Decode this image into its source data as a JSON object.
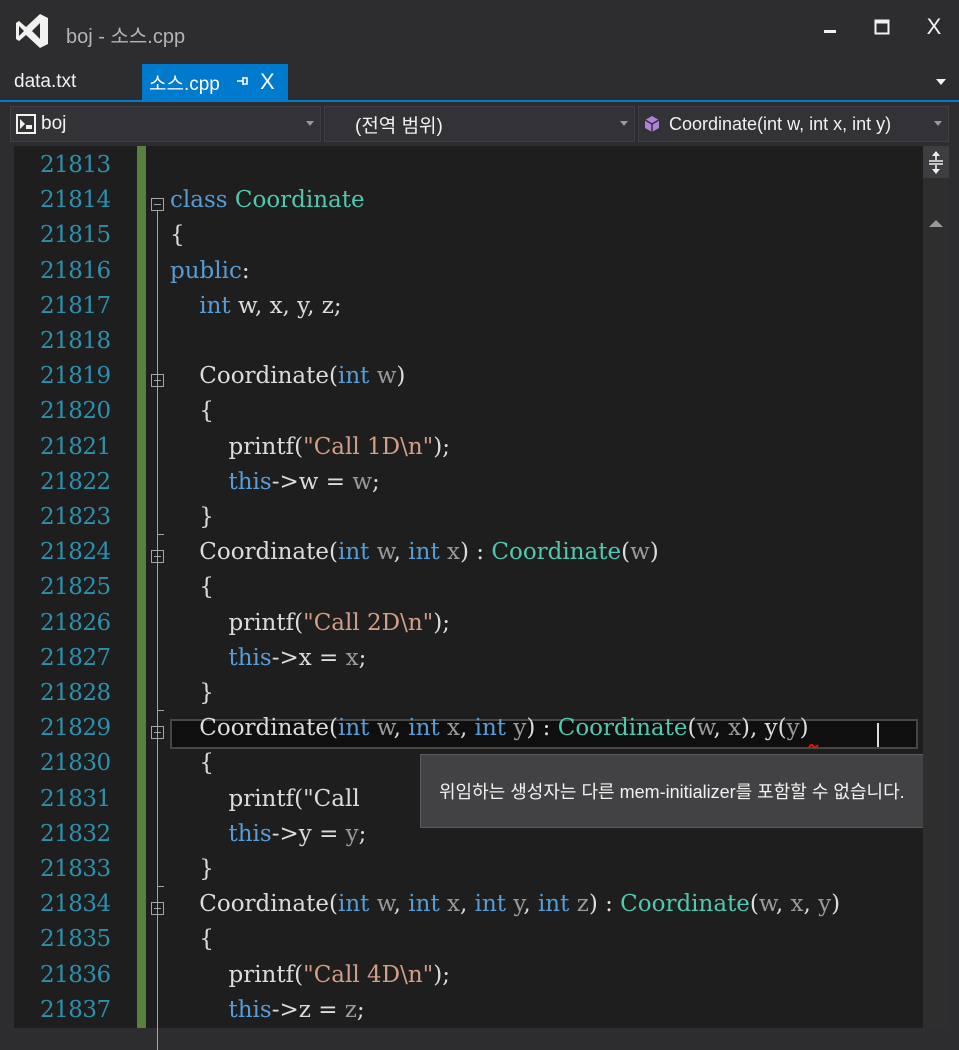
{
  "window": {
    "title": "boj - 소스.cpp",
    "minimize_icon": "minimize-icon",
    "maximize_icon": "maximize-icon",
    "close_label": "X"
  },
  "tabs": [
    {
      "label": "data.txt",
      "active": false
    },
    {
      "label": "소스.cpp",
      "active": true,
      "close_label": "X"
    }
  ],
  "navbar": {
    "project": "boj",
    "scope": "(전역 범위)",
    "member": "Coordinate(int w, int x, int y)"
  },
  "editor": {
    "line_numbers": [
      "21813",
      "21814",
      "21815",
      "21816",
      "21817",
      "21818",
      "21819",
      "21820",
      "21821",
      "21822",
      "21823",
      "21824",
      "21825",
      "21826",
      "21827",
      "21828",
      "21829",
      "21830",
      "21831",
      "21832",
      "21833",
      "21834",
      "21835",
      "21836",
      "21837"
    ],
    "lines": [
      [],
      [
        {
          "t": "class",
          "c": "kw"
        },
        {
          "t": " "
        },
        {
          "t": "Coordinate",
          "c": "ty"
        }
      ],
      [
        {
          "t": "{"
        }
      ],
      [
        {
          "t": "public",
          "c": "kw"
        },
        {
          "t": ":"
        }
      ],
      [
        {
          "t": "    "
        },
        {
          "t": "int",
          "c": "kw"
        },
        {
          "t": " w, x, y, z;"
        }
      ],
      [],
      [
        {
          "t": "    Coordinate("
        },
        {
          "t": "int",
          "c": "kw"
        },
        {
          "t": " "
        },
        {
          "t": "w",
          "c": "pm"
        },
        {
          "t": ")"
        }
      ],
      [
        {
          "t": "    {"
        }
      ],
      [
        {
          "t": "        printf("
        },
        {
          "t": "\"Call 1D\\n\"",
          "c": "st"
        },
        {
          "t": ");"
        }
      ],
      [
        {
          "t": "        "
        },
        {
          "t": "this",
          "c": "kw"
        },
        {
          "t": "->w = "
        },
        {
          "t": "w",
          "c": "pm"
        },
        {
          "t": ";"
        }
      ],
      [
        {
          "t": "    }"
        }
      ],
      [
        {
          "t": "    Coordinate("
        },
        {
          "t": "int",
          "c": "kw"
        },
        {
          "t": " "
        },
        {
          "t": "w",
          "c": "pm"
        },
        {
          "t": ", "
        },
        {
          "t": "int",
          "c": "kw"
        },
        {
          "t": " "
        },
        {
          "t": "x",
          "c": "pm"
        },
        {
          "t": ") : "
        },
        {
          "t": "Coordinate",
          "c": "ty"
        },
        {
          "t": "("
        },
        {
          "t": "w",
          "c": "pm"
        },
        {
          "t": ")"
        }
      ],
      [
        {
          "t": "    {"
        }
      ],
      [
        {
          "t": "        printf("
        },
        {
          "t": "\"Call 2D\\n\"",
          "c": "st"
        },
        {
          "t": ");"
        }
      ],
      [
        {
          "t": "        "
        },
        {
          "t": "this",
          "c": "kw"
        },
        {
          "t": "->x = "
        },
        {
          "t": "x",
          "c": "pm"
        },
        {
          "t": ";"
        }
      ],
      [
        {
          "t": "    }"
        }
      ],
      [
        {
          "t": "    Coordinate("
        },
        {
          "t": "int",
          "c": "kw"
        },
        {
          "t": " "
        },
        {
          "t": "w",
          "c": "pm"
        },
        {
          "t": ", "
        },
        {
          "t": "int",
          "c": "kw"
        },
        {
          "t": " "
        },
        {
          "t": "x",
          "c": "pm"
        },
        {
          "t": ", "
        },
        {
          "t": "int",
          "c": "kw"
        },
        {
          "t": " "
        },
        {
          "t": "y",
          "c": "pm"
        },
        {
          "t": ") : "
        },
        {
          "t": "Coordinate",
          "c": "ty"
        },
        {
          "t": "("
        },
        {
          "t": "w",
          "c": "pm"
        },
        {
          "t": ", "
        },
        {
          "t": "x",
          "c": "pm"
        },
        {
          "t": "), y("
        },
        {
          "t": "y",
          "c": "pm"
        },
        {
          "t": ")"
        }
      ],
      [
        {
          "t": "    {"
        }
      ],
      [
        {
          "t": "        printf(\"Call "
        }
      ],
      [
        {
          "t": "        "
        },
        {
          "t": "this",
          "c": "kw"
        },
        {
          "t": "->y = "
        },
        {
          "t": "y",
          "c": "pm"
        },
        {
          "t": ";"
        }
      ],
      [
        {
          "t": "    }"
        }
      ],
      [
        {
          "t": "    Coordinate("
        },
        {
          "t": "int",
          "c": "kw"
        },
        {
          "t": " "
        },
        {
          "t": "w",
          "c": "pm"
        },
        {
          "t": ", "
        },
        {
          "t": "int",
          "c": "kw"
        },
        {
          "t": " "
        },
        {
          "t": "x",
          "c": "pm"
        },
        {
          "t": ", "
        },
        {
          "t": "int",
          "c": "kw"
        },
        {
          "t": " "
        },
        {
          "t": "y",
          "c": "pm"
        },
        {
          "t": ", "
        },
        {
          "t": "int",
          "c": "kw"
        },
        {
          "t": " "
        },
        {
          "t": "z",
          "c": "pm"
        },
        {
          "t": ") : "
        },
        {
          "t": "Coordinate",
          "c": "ty"
        },
        {
          "t": "("
        },
        {
          "t": "w",
          "c": "pm"
        },
        {
          "t": ", "
        },
        {
          "t": "x",
          "c": "pm"
        },
        {
          "t": ", "
        },
        {
          "t": "y",
          "c": "pm"
        },
        {
          "t": ")"
        }
      ],
      [
        {
          "t": "    {"
        }
      ],
      [
        {
          "t": "        printf("
        },
        {
          "t": "\"Call 4D\\n\"",
          "c": "st"
        },
        {
          "t": ");"
        }
      ],
      [
        {
          "t": "        "
        },
        {
          "t": "this",
          "c": "kw"
        },
        {
          "t": "->z = "
        },
        {
          "t": "z",
          "c": "pm"
        },
        {
          "t": ";"
        }
      ]
    ]
  },
  "tooltip": {
    "text": "위임하는 생성자는 다른 mem-initializer를 포함할 수 없습니다."
  },
  "colors": {
    "keyword": "#569cd6",
    "type": "#4ec9b0",
    "string": "#d69d85",
    "parameter": "#9a9a9a",
    "line_number": "#2b91af",
    "accent": "#007acc",
    "change_bar": "#57803a"
  }
}
